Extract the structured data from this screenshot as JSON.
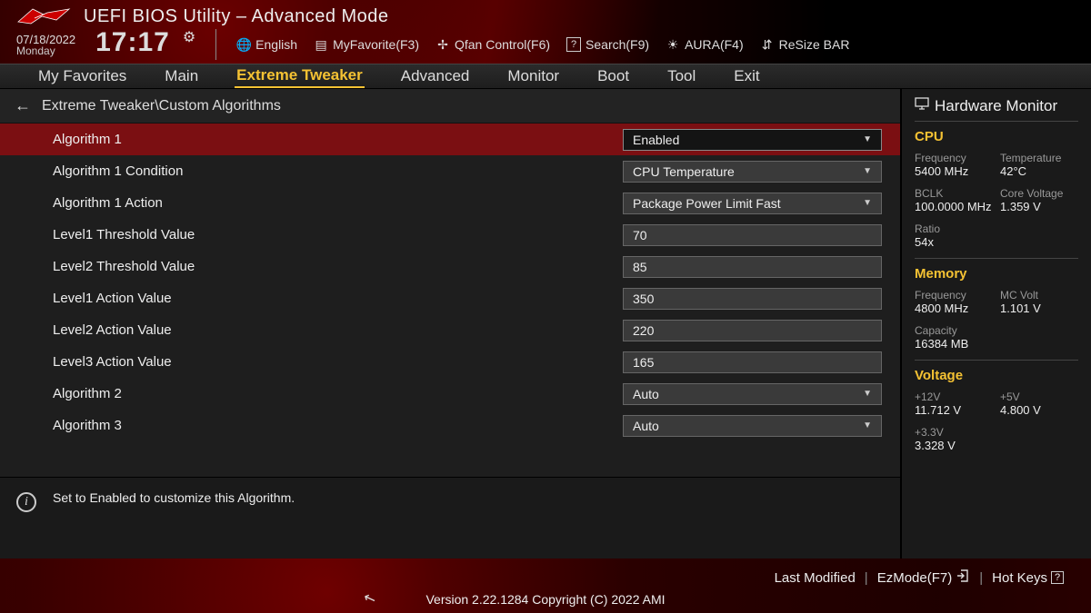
{
  "header": {
    "app_title": "UEFI BIOS Utility – Advanced Mode",
    "date": "07/18/2022",
    "day": "Monday",
    "time": "17:17",
    "items": {
      "language": "English",
      "favorite": "MyFavorite(F3)",
      "qfan": "Qfan Control(F6)",
      "search": "Search(F9)",
      "aura": "AURA(F4)",
      "resize": "ReSize BAR"
    }
  },
  "tabs": [
    "My Favorites",
    "Main",
    "Extreme Tweaker",
    "Advanced",
    "Monitor",
    "Boot",
    "Tool",
    "Exit"
  ],
  "active_tab": "Extreme Tweaker",
  "breadcrumb": "Extreme Tweaker\\Custom Algorithms",
  "rows": [
    {
      "label": "Algorithm 1",
      "type": "dd",
      "value": "Enabled",
      "sel": true
    },
    {
      "label": "Algorithm 1 Condition",
      "type": "dd",
      "value": "CPU Temperature"
    },
    {
      "label": "Algorithm 1 Action",
      "type": "dd",
      "value": "Package Power Limit Fast"
    },
    {
      "label": "Level1 Threshold Value",
      "type": "in",
      "value": "70"
    },
    {
      "label": "Level2 Threshold Value",
      "type": "in",
      "value": "85"
    },
    {
      "label": "Level1 Action Value",
      "type": "in",
      "value": "350"
    },
    {
      "label": "Level2 Action Value",
      "type": "in",
      "value": "220"
    },
    {
      "label": "Level3 Action Value",
      "type": "in",
      "value": "165"
    },
    {
      "label": "Algorithm 2",
      "type": "dd",
      "value": "Auto"
    },
    {
      "label": "Algorithm 3",
      "type": "dd",
      "value": "Auto"
    }
  ],
  "help_text": "Set to Enabled to customize this Algorithm.",
  "hw": {
    "title": "Hardware Monitor",
    "cpu": {
      "heading": "CPU",
      "freq_k": "Frequency",
      "freq_v": "5400 MHz",
      "temp_k": "Temperature",
      "temp_v": "42°C",
      "bclk_k": "BCLK",
      "bclk_v": "100.0000 MHz",
      "cv_k": "Core Voltage",
      "cv_v": "1.359 V",
      "ratio_k": "Ratio",
      "ratio_v": "54x"
    },
    "mem": {
      "heading": "Memory",
      "freq_k": "Frequency",
      "freq_v": "4800 MHz",
      "mc_k": "MC Volt",
      "mc_v": "1.101 V",
      "cap_k": "Capacity",
      "cap_v": "16384 MB"
    },
    "volt": {
      "heading": "Voltage",
      "v12_k": "+12V",
      "v12_v": "11.712 V",
      "v5_k": "+5V",
      "v5_v": "4.800 V",
      "v33_k": "+3.3V",
      "v33_v": "3.328 V"
    }
  },
  "footer": {
    "last_modified": "Last Modified",
    "ezmode": "EzMode(F7)",
    "hotkeys": "Hot Keys",
    "version": "Version 2.22.1284 Copyright (C) 2022 AMI"
  }
}
